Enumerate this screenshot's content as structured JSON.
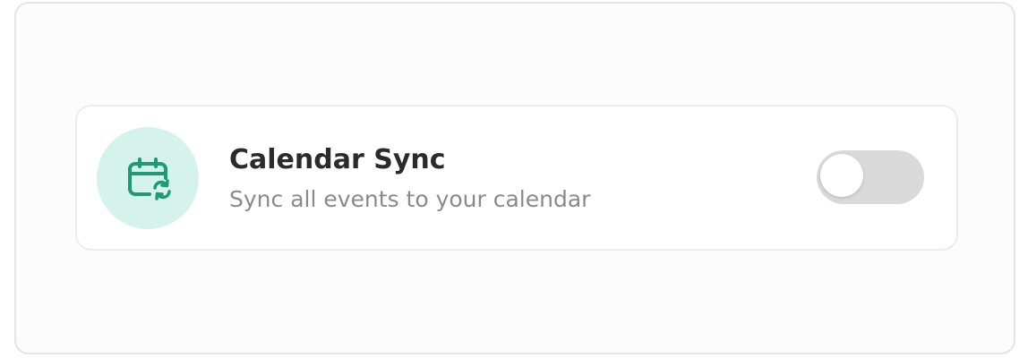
{
  "setting": {
    "title": "Calendar Sync",
    "description": "Sync all events to your calendar",
    "icon": "calendar-sync-icon",
    "enabled": false
  },
  "colors": {
    "icon_bg": "#d5f3ea",
    "icon_stroke": "#1e9b72",
    "toggle_off": "#d9d9d9"
  }
}
